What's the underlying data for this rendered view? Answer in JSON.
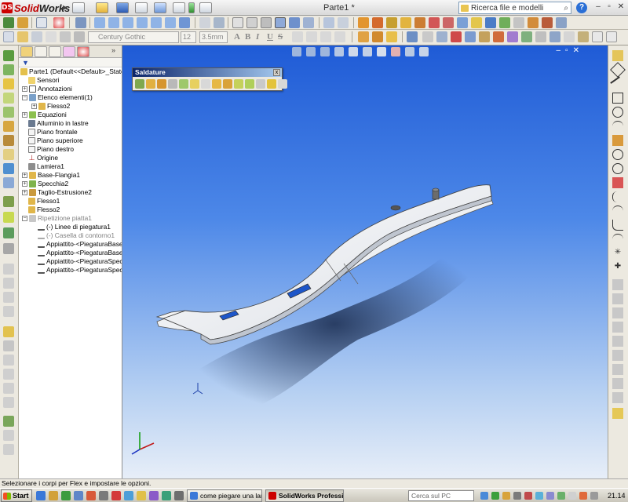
{
  "app": {
    "logo_prefix": "Solid",
    "logo_suffix": "Works",
    "document_title": "Parte1 *",
    "search_placeholder": "Ricerca file e modelli",
    "help_label": "?"
  },
  "toolbar2": {
    "font_name": "Century Gothic",
    "font_size": "12",
    "line_height": "3.5mm",
    "format_labels": [
      "A",
      "B",
      "I",
      "U",
      "S"
    ]
  },
  "feature_tree": {
    "root": "Parte1  (Default<<Default>_Stato di",
    "items": [
      {
        "label": "Sensori",
        "icon": "sensor-icon"
      },
      {
        "label": "Annotazioni",
        "icon": "annotation-icon"
      },
      {
        "label": "Elenco elementi(1)",
        "icon": "cut-list-icon"
      },
      {
        "label": "Flesso2",
        "icon": "flex-icon"
      },
      {
        "label": "Equazioni",
        "icon": "equation-icon"
      },
      {
        "label": "Alluminio in lastre",
        "icon": "material-icon"
      },
      {
        "label": "Piano frontale",
        "icon": "plane-icon"
      },
      {
        "label": "Piano superiore",
        "icon": "plane-icon"
      },
      {
        "label": "Piano destro",
        "icon": "plane-icon"
      },
      {
        "label": "Origine",
        "icon": "origin-icon"
      },
      {
        "label": "Lamiera1",
        "icon": "sheet-metal-icon"
      },
      {
        "label": "Base-Flangia1",
        "icon": "base-flange-icon"
      },
      {
        "label": "Specchia2",
        "icon": "mirror-icon"
      },
      {
        "label": "Taglio-Estrusione2",
        "icon": "cut-extrude-icon"
      },
      {
        "label": "Flesso1",
        "icon": "flex-icon"
      },
      {
        "label": "Flesso2",
        "icon": "flex-icon"
      },
      {
        "label": "Ripetizione piatta1",
        "icon": "flat-pattern-icon"
      },
      {
        "label": "(-) Linee di piegatura1",
        "icon": "bend-lines-icon"
      },
      {
        "label": "(-) Casella di contorno1",
        "icon": "bounding-box-icon"
      },
      {
        "label": "Appiattito-<PiegaturaBase1>1",
        "icon": "flatten-icon"
      },
      {
        "label": "Appiattito-<PiegaturaBase2>1",
        "icon": "flatten-icon"
      },
      {
        "label": "Appiattito-<PiegaturaSpecchio",
        "icon": "flatten-icon"
      },
      {
        "label": "Appiattito-<PiegaturaSpecchio",
        "icon": "flatten-icon"
      }
    ]
  },
  "weldments_toolbar": {
    "title": "Saldature",
    "close_label": "x"
  },
  "status_bar": {
    "message": "Selezionare i corpi per Flex e impostare le opzioni."
  },
  "taskbar": {
    "start_label": "Start",
    "tasks": [
      {
        "label": "come piegare una lamier...",
        "active": false
      },
      {
        "label": "SolidWorks Professio...",
        "active": true
      }
    ],
    "search_placeholder": "Cerca sul PC",
    "clock": "21.14"
  },
  "colors": {
    "viewport_top": "#1f5bd6",
    "viewport_bottom": "#e7eef8",
    "brand": "#c00000"
  }
}
